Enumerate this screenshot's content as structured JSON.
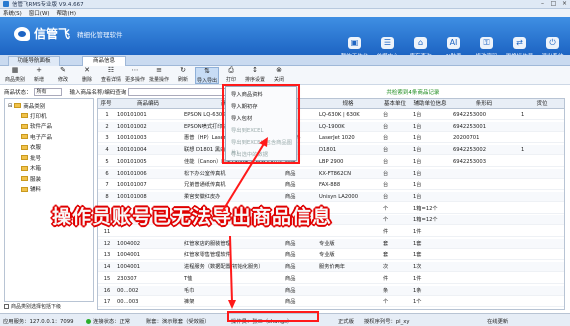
{
  "window": {
    "title": "信管飞RMS专业版 V9.4.667",
    "controls": [
      "–",
      "□",
      "×"
    ]
  },
  "menubar": [
    "系统(S)",
    "窗口(W)",
    "帮助(H)"
  ],
  "brand": {
    "name": "信管飞",
    "slogan": "精细化管理软件"
  },
  "topnav": [
    {
      "label": "我的工作台",
      "icon": "desktop-icon",
      "glyph": "▣"
    },
    {
      "label": "单据中心",
      "icon": "documents-icon",
      "glyph": "☰"
    },
    {
      "label": "库存查询",
      "icon": "warehouse-icon",
      "glyph": "⌂"
    },
    {
      "label": "AI助手",
      "icon": "ai-icon",
      "glyph": "AI"
    },
    {
      "label": "修改密码",
      "icon": "password-icon",
      "glyph": "⚿"
    },
    {
      "label": "更换操作员",
      "icon": "switch-user-icon",
      "glyph": "⇄"
    },
    {
      "label": "退出系统",
      "icon": "exit-icon",
      "glyph": "⏻"
    }
  ],
  "tabs": [
    "功能导航面板",
    "商品信息"
  ],
  "toolbar": [
    {
      "label": "商品类别",
      "icon": "category-icon",
      "glyph": "▦"
    },
    {
      "label": "新增",
      "icon": "add-icon",
      "glyph": "+"
    },
    {
      "label": "修改",
      "icon": "edit-icon",
      "glyph": "✎"
    },
    {
      "label": "删除",
      "icon": "delete-icon",
      "glyph": "✕"
    },
    {
      "label": "查看详情",
      "icon": "detail-icon",
      "glyph": "☷"
    },
    {
      "label": "更多操作",
      "icon": "more-icon",
      "glyph": "⋯"
    },
    {
      "label": "批量操作",
      "icon": "batch-icon",
      "glyph": "≡"
    },
    {
      "label": "刷新",
      "icon": "refresh-icon",
      "glyph": "↻"
    },
    {
      "label": "导入导出",
      "icon": "import-export-icon",
      "glyph": "⇅"
    },
    {
      "label": "打印",
      "icon": "print-icon",
      "glyph": "⎙"
    },
    {
      "label": "排序设置",
      "icon": "sort-icon",
      "glyph": "↕"
    },
    {
      "label": "关闭",
      "icon": "close-icon",
      "glyph": "⊗"
    }
  ],
  "filter": {
    "status_label": "商品状态",
    "status_value": "所有",
    "search_hint": "输入商品名称/编码查询",
    "exact_label": "精确",
    "result_text": "共检索到4条商品记录"
  },
  "tree": {
    "root": "商品类别",
    "items": [
      "打印机",
      "软件产品",
      "电子产品",
      "衣服",
      "批号",
      "木箱",
      "服装",
      "辅料"
    ],
    "footer": "商品类别选择包括下级"
  },
  "grid": {
    "headers": [
      "序号",
      "商品编码",
      "商品名称",
      "规格",
      "基本单位",
      "辅助单位信息",
      "条形码",
      "货位"
    ],
    "rows": [
      [
        "1",
        "100101001",
        "EPSON LQ-630K 打印机",
        "商品",
        "LQ-630K | 630K",
        "台",
        "1台",
        "6942253000",
        "1"
      ],
      [
        "2",
        "100101002",
        "EPSON喷式打印机",
        "商品",
        "LQ-1900K",
        "台",
        "1台",
        "6942253001",
        ""
      ],
      [
        "3",
        "100101003",
        "惠普（HP）LaserJet 1020",
        "原材料",
        "LaserJet 1020",
        "台",
        "1台",
        "20200701",
        ""
      ],
      [
        "4",
        "100101004",
        "联想 D1801 黑白激光",
        "商品",
        "D1801",
        "台",
        "1台",
        "6942253002",
        "1"
      ],
      [
        "5",
        "100101005",
        "佳能（Canon）LBP2900+ 黑白激光打印机",
        "商品",
        "LBP 2900",
        "台",
        "1台",
        "6942253003",
        ""
      ],
      [
        "6",
        "100101006",
        "松下办公室传真机",
        "商品",
        "KX-FT862CN",
        "台",
        "1台",
        "",
        ""
      ],
      [
        "7",
        "100101007",
        "兄弟普通纸传真机",
        "商品",
        "FAX-888",
        "台",
        "1台",
        "",
        ""
      ],
      [
        "8",
        "100101008",
        "柔宫安徽红皮办",
        "商品",
        "Unisyn LA2000",
        "台",
        "1台",
        "",
        ""
      ],
      [
        "9",
        "",
        "",
        "",
        "",
        "个",
        "1箱=12个",
        "",
        ""
      ],
      [
        "10",
        "",
        "",
        "",
        "",
        "个",
        "1箱=12个",
        "",
        ""
      ],
      [
        "11",
        "",
        "",
        "",
        "",
        "件",
        "1件",
        "",
        ""
      ],
      [
        "12",
        "1004002",
        "红管家店的服装管理",
        "商品",
        "专业版",
        "套",
        "1套",
        "",
        ""
      ],
      [
        "13",
        "1004001",
        "红管家零售管理软件",
        "商品",
        "专业版",
        "套",
        "1套",
        "",
        ""
      ],
      [
        "14",
        "1004001",
        "进程服务（数据配置/初始化服务）",
        "商品",
        "服务价两年",
        "次",
        "1次",
        "",
        ""
      ],
      [
        "15",
        "230307",
        "T恤",
        "商品",
        "",
        "件",
        "1件",
        "",
        ""
      ],
      [
        "16",
        "00...002",
        "毛巾",
        "商品",
        "",
        "条",
        "1条",
        "",
        ""
      ],
      [
        "17",
        "00...003",
        "裤架",
        "商品",
        "",
        "个",
        "1个",
        "",
        ""
      ]
    ]
  },
  "dropdown": {
    "items": [
      {
        "label": "导入商品资料",
        "enabled": true
      },
      {
        "label": "导入期初存",
        "enabled": true
      },
      {
        "label": "导入包材",
        "enabled": true
      },
      {
        "label": "导出到EXCEL",
        "enabled": false
      },
      {
        "label": "导出到EXCEL(包含商品图片)",
        "enabled": false
      },
      {
        "label": "导出选中的数据",
        "enabled": false
      }
    ]
  },
  "callout": "操作员账号已无法导出商品信息",
  "status": {
    "server": "应用服务：127.0.0.1：7099",
    "connection": "连接状态：正常",
    "ledger": "账套：演示账套（受效版）",
    "operator": "操作员：张三（zhangs）",
    "edition": "正式版",
    "serial": "授权序列号：pl_xy",
    "update": "在线更新"
  },
  "colors": {
    "banner": "#1d64c3",
    "callout_outline": "#e00000",
    "highlight_box": "#ff1a1a",
    "ok_dot": "#2cae2c"
  }
}
